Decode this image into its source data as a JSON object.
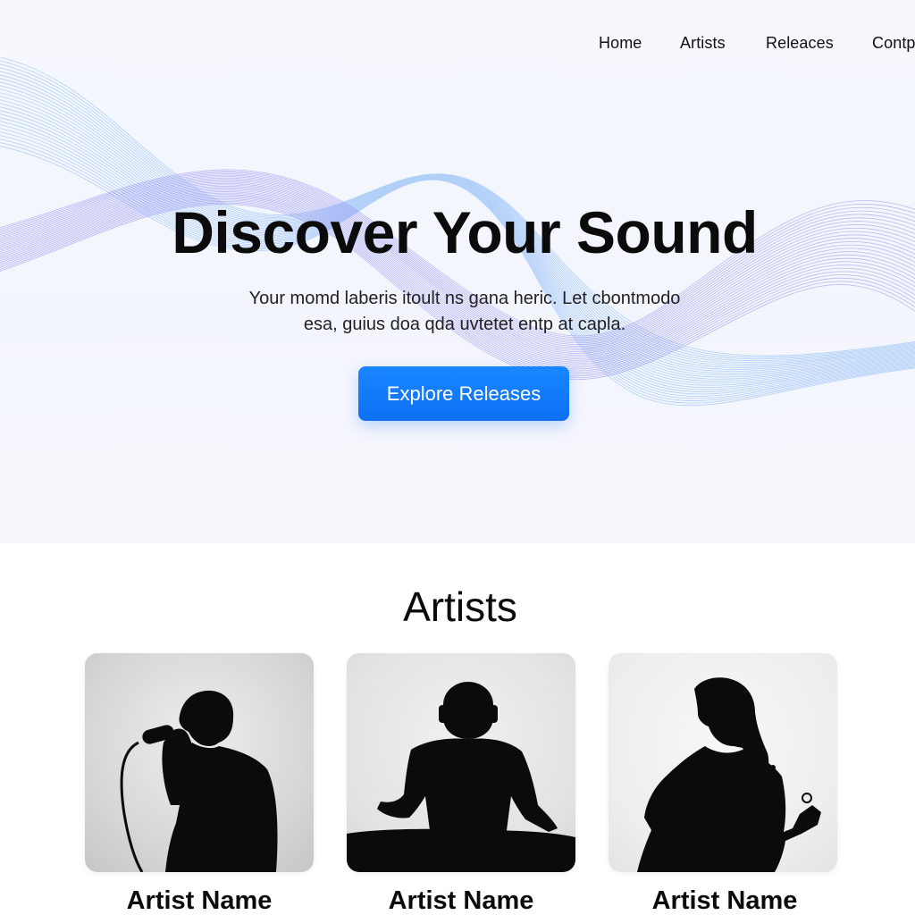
{
  "nav": {
    "items": [
      "Home",
      "Artists",
      "Releaces",
      "Contp"
    ]
  },
  "hero": {
    "title": "Discover Your Sound",
    "text_line1": "Your momd laberis itoult ns gana heric. Let cbontmodo",
    "text_line2": "esa, guius doa qda uvtetet entp at capla.",
    "cta_label": "Explore Releases"
  },
  "artists": {
    "heading": "Artists",
    "cards": [
      {
        "name": "Artist Name",
        "icon": "singer-silhouette-icon"
      },
      {
        "name": "Artist Name",
        "icon": "dj-silhouette-icon"
      },
      {
        "name": "Artist Name",
        "icon": "guitarist-silhouette-icon"
      }
    ]
  },
  "colors": {
    "accent": "#1787ff",
    "wave_blue": "#7cb2f5",
    "wave_violet": "#8a86ef",
    "hero_bg": "#f4f6fd"
  }
}
